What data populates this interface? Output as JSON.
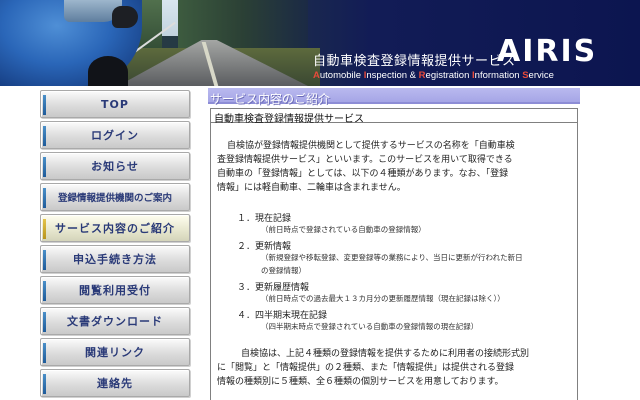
{
  "header": {
    "site_title": "自動車検査登録情報提供サービス",
    "logo_text": "AIRIS",
    "subtitle_parts": [
      {
        "text": "A",
        "initial": true
      },
      {
        "text": "utomobile ",
        "initial": false
      },
      {
        "text": "I",
        "initial": true
      },
      {
        "text": "nspection & ",
        "initial": false
      },
      {
        "text": "R",
        "initial": true
      },
      {
        "text": "egistration ",
        "initial": false
      },
      {
        "text": "I",
        "initial": true
      },
      {
        "text": "nformation ",
        "initial": false
      },
      {
        "text": "S",
        "initial": true
      },
      {
        "text": "ervice",
        "initial": false
      }
    ]
  },
  "sidebar": {
    "items": [
      {
        "label": "TOP"
      },
      {
        "label": "ログイン"
      },
      {
        "label": "お知らせ"
      },
      {
        "label": "登録情報提供機関のご案内"
      },
      {
        "label": "サービス内容のご紹介"
      },
      {
        "label": "申込手続き方法"
      },
      {
        "label": "閲覧利用受付"
      },
      {
        "label": "文書ダウンロード"
      },
      {
        "label": "関連リンク"
      },
      {
        "label": "連絡先"
      }
    ]
  },
  "main": {
    "section_heading": "サービス内容のご紹介",
    "panel_title": "自動車検査登録情報提供サービス",
    "intro_lines": [
      "自検協が登録情報提供機関として提供するサービスの名称を「自動車検",
      "査登録情報提供サービス」といいます。このサービスを用いて取得できる",
      "自動車の「登録情報」としては、以下の４種類があります。なお、「登録",
      "情報」には軽自動車、二輪車は含まれません。"
    ],
    "items": [
      {
        "title": "１．現在記録",
        "notes": [
          "（前日時点で登録されている自動車の登録情報）"
        ]
      },
      {
        "title": "２．更新情報",
        "notes": [
          "（新規登録や移転登録、変更登録等の業務により、当日に更新が行われた新日",
          "の登録情報）"
        ]
      },
      {
        "title": "３．更新履歴情報",
        "notes": [
          "（前日時点での過去最大１３カ月分の更新履歴情報（現在記録は除く））"
        ]
      },
      {
        "title": "４．四半期末現在記録",
        "notes": [
          "（四半期末時点で登録されている自動車の登録情報の現在記録）"
        ]
      }
    ],
    "closing_lines": [
      "自検協は、上記４種類の登録情報を提供するために利用者の接続形式別",
      "に「閲覧」と「情報提供」の２種類、また「情報提供」は提供される登録",
      "情報の種類別に５種類、全６種類の個別サービスを用意しております。"
    ]
  }
}
